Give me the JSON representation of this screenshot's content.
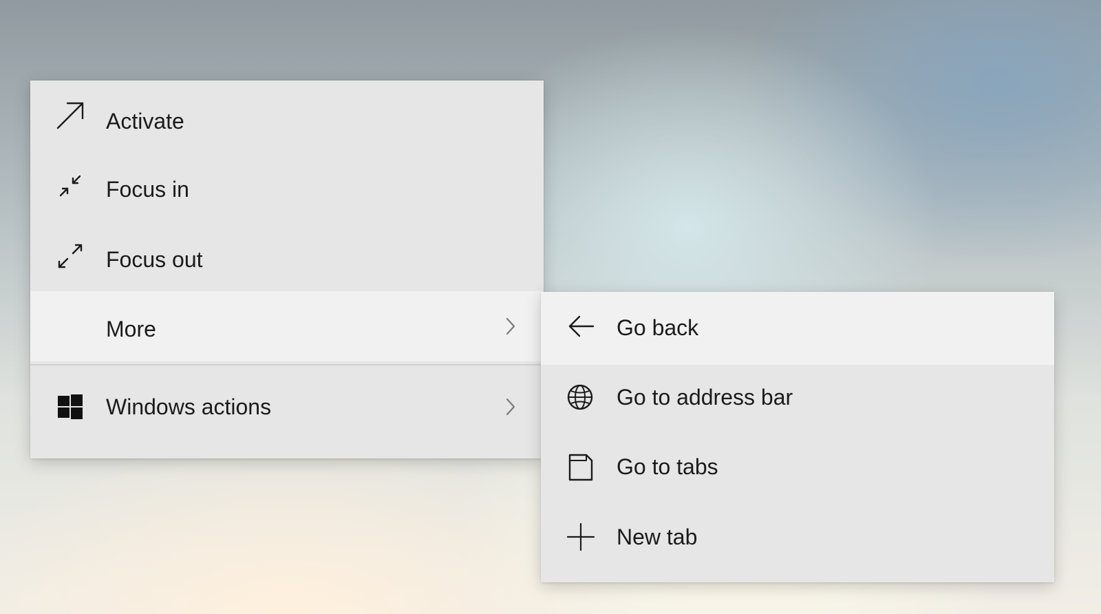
{
  "primary_menu": {
    "items": [
      {
        "label": "Activate",
        "icon": "arrow-up-right-icon"
      },
      {
        "label": "Focus in",
        "icon": "focus-in-icon"
      },
      {
        "label": "Focus out",
        "icon": "focus-out-icon"
      },
      {
        "label": "More",
        "icon": "",
        "has_submenu": true,
        "highlighted": true
      },
      {
        "label": "Windows actions",
        "icon": "windows-logo-icon",
        "has_submenu": true
      }
    ]
  },
  "submenu": {
    "items": [
      {
        "label": "Go back",
        "icon": "arrow-left-icon",
        "highlighted": true
      },
      {
        "label": "Go to address bar",
        "icon": "globe-icon"
      },
      {
        "label": "Go to tabs",
        "icon": "tabs-icon"
      },
      {
        "label": "New tab",
        "icon": "plus-icon"
      }
    ]
  },
  "colors": {
    "menu_background": "#e6e6e6",
    "highlight_background": "#f1f1f1",
    "text": "#1b1b1b",
    "icon": "#1b1b1b",
    "chevron": "#7a7a7a"
  }
}
